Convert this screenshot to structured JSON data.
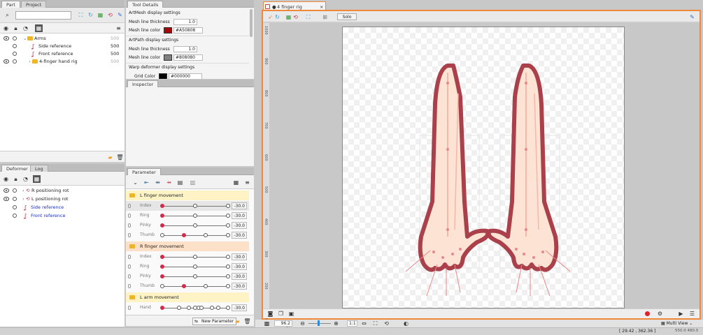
{
  "left_top": {
    "tabs": [
      "Part",
      "Project"
    ],
    "search_placeholder": "",
    "rows": [
      {
        "label": "Arms",
        "value": "500",
        "indent": 0,
        "kind": "folder",
        "open": true
      },
      {
        "label": "Side reference",
        "value": "500",
        "indent": 1,
        "kind": "image"
      },
      {
        "label": "Front reference",
        "value": "500",
        "indent": 1,
        "kind": "image"
      },
      {
        "label": "4-finger hand rig",
        "value": "500",
        "indent": 1,
        "kind": "folder",
        "open": false
      }
    ]
  },
  "left_bottom": {
    "tabs": [
      "Deformer",
      "Log"
    ],
    "rows": [
      {
        "label": "R positioning rot",
        "indent": 0
      },
      {
        "label": "L positioning rot",
        "indent": 0
      },
      {
        "label": "Side reference",
        "indent": 1
      },
      {
        "label": "Front reference",
        "indent": 1
      }
    ]
  },
  "tool_details": {
    "tab": "Tool Details",
    "sections": [
      {
        "title": "ArtMesh display settings",
        "props": [
          {
            "name": "Mesh line thickness",
            "value": "1.0"
          },
          {
            "name": "Mesh line color",
            "value": "#A50808",
            "swatch": "#A50808"
          }
        ]
      },
      {
        "title": "ArtPath display settings",
        "props": [
          {
            "name": "Mesh line thickness",
            "value": "1.0"
          },
          {
            "name": "Mesh line color",
            "value": "#808080",
            "swatch": "#808080"
          }
        ]
      },
      {
        "title": "Warp deformer display settings",
        "props": [
          {
            "name": "Grid Color",
            "value": "#000000",
            "swatch": "#000000"
          }
        ]
      }
    ]
  },
  "inspector": {
    "tab": "Inspector"
  },
  "parameter": {
    "tab": "Parameter",
    "new_param": "New Parameter",
    "groups": [
      {
        "name": "L finger movement",
        "params": [
          {
            "name": "Index",
            "value": "-30.0",
            "knobs": [
              0,
              0.5,
              1
            ],
            "red": 0,
            "highlight": true
          },
          {
            "name": "Ring",
            "value": "-30.0",
            "knobs": [
              0,
              0.5,
              1
            ],
            "red": 0
          },
          {
            "name": "Pinky",
            "value": "-30.0",
            "knobs": [
              0,
              0.5,
              1
            ],
            "red": 0
          },
          {
            "name": "Thumb",
            "value": "-30.0",
            "knobs": [
              0,
              0.33,
              0.66,
              1
            ],
            "red": 1
          }
        ]
      },
      {
        "name": "R finger movement",
        "params": [
          {
            "name": "Index",
            "value": "-30.0",
            "knobs": [
              0,
              0.5,
              1
            ],
            "red": 0
          },
          {
            "name": "Ring",
            "value": "-30.0",
            "knobs": [
              0,
              0.5,
              1
            ],
            "red": 0
          },
          {
            "name": "Pinky",
            "value": "-30.0",
            "knobs": [
              0,
              0.5,
              1
            ],
            "red": 0
          },
          {
            "name": "Thumb",
            "value": "-30.0",
            "knobs": [
              0,
              0.33,
              0.66,
              1
            ],
            "red": 1
          }
        ]
      },
      {
        "name": "L arm movement",
        "params": [
          {
            "name": "Hand angle X",
            "value": "-30.0",
            "knobs": [
              0,
              0.25,
              0.4,
              0.5,
              0.55,
              0.6,
              0.75,
              0.85,
              1
            ],
            "red": 0
          }
        ]
      }
    ]
  },
  "viewport": {
    "tab": "4 finger rig",
    "solo": "Solo",
    "zoom": "96.2 %",
    "page": "1:1",
    "mode": "Multi View",
    "coords": "[  29.42 ,  362.36 ]",
    "zoomlabel": "550.0 480.0",
    "ruler": [
      "1000",
      "900",
      "800",
      "700",
      "600",
      "500",
      "400",
      "300",
      "200",
      "100"
    ]
  },
  "colors": {
    "accent": "#f0883a",
    "mesh": "#A50808",
    "skin": "#fde3d3",
    "outline": "#a9404a"
  }
}
